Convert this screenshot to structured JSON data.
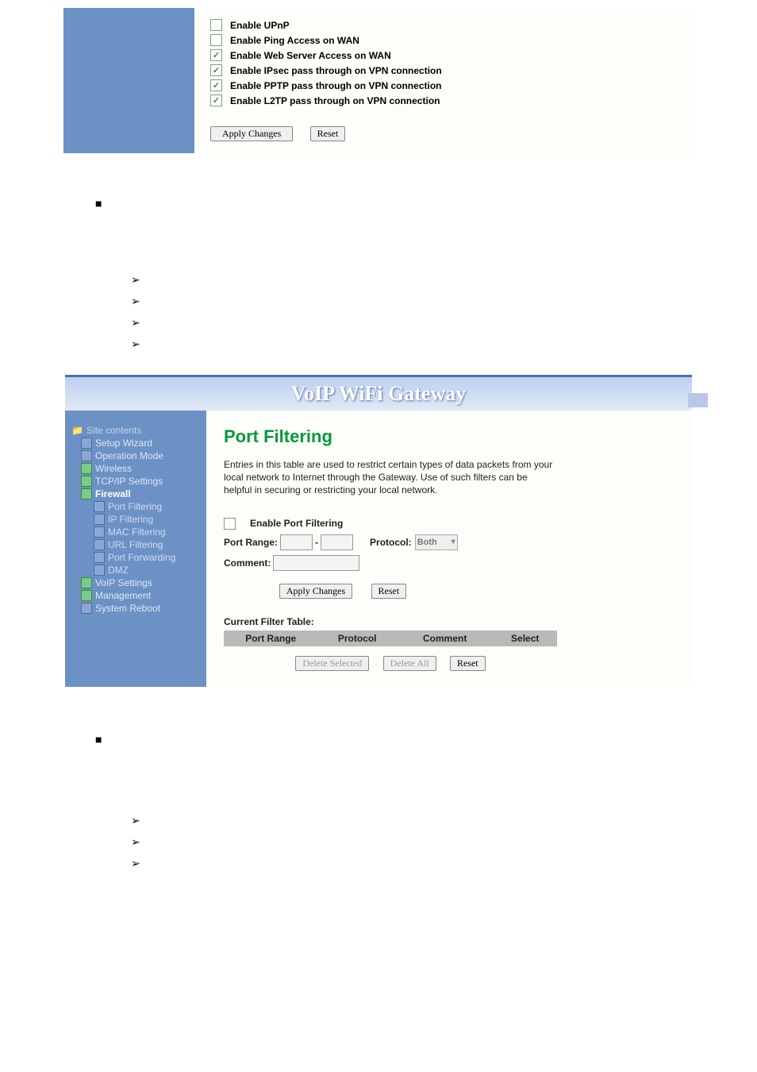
{
  "panel1": {
    "options": [
      {
        "label": "Enable UPnP",
        "checked": false
      },
      {
        "label": "Enable Ping Access on WAN",
        "checked": false
      },
      {
        "label": "Enable Web Server Access on WAN",
        "checked": true
      },
      {
        "label": "Enable IPsec pass through on VPN connection",
        "checked": true
      },
      {
        "label": "Enable PPTP pass through on VPN connection",
        "checked": true
      },
      {
        "label": "Enable L2TP pass through on VPN connection",
        "checked": true
      }
    ],
    "apply_label": "Apply Changes",
    "reset_label": "Reset"
  },
  "panel2": {
    "app_title": "VoIP WiFi Gateway",
    "page_title": "Port Filtering",
    "description": "Entries in this table are used to restrict certain types of data packets from your local network to Internet through the Gateway. Use of such filters can be helpful in securing or restricting your local network.",
    "enable_label": "Enable Port Filtering",
    "port_range_label": "Port Range:",
    "protocol_label": "Protocol:",
    "protocol_value": "Both",
    "comment_label": "Comment:",
    "apply_label": "Apply Changes",
    "reset_label": "Reset",
    "table_title": "Current Filter Table:",
    "table_headers": {
      "c1": "Port Range",
      "c2": "Protocol",
      "c3": "Comment",
      "c4": "Select"
    },
    "delete_selected": "Delete Selected",
    "delete_all": "Delete All",
    "reset2": "Reset"
  },
  "sidebar": {
    "root": "Site contents",
    "items": [
      {
        "label": "Setup Wizard",
        "type": "page"
      },
      {
        "label": "Operation Mode",
        "type": "page"
      },
      {
        "label": "Wireless",
        "type": "folder"
      },
      {
        "label": "TCP/IP Settings",
        "type": "folder"
      },
      {
        "label": "Firewall",
        "type": "folder",
        "hl": true
      },
      {
        "label": "Port Filtering",
        "type": "page",
        "level": 2
      },
      {
        "label": "IP Filtering",
        "type": "page",
        "level": 2
      },
      {
        "label": "MAC Filtering",
        "type": "page",
        "level": 2
      },
      {
        "label": "URL Filtering",
        "type": "page",
        "level": 2
      },
      {
        "label": "Port Forwarding",
        "type": "page",
        "level": 2
      },
      {
        "label": "DMZ",
        "type": "page",
        "level": 2
      },
      {
        "label": "VoIP Settings",
        "type": "folder"
      },
      {
        "label": "Management",
        "type": "folder"
      },
      {
        "label": "System Reboot",
        "type": "page"
      }
    ]
  }
}
